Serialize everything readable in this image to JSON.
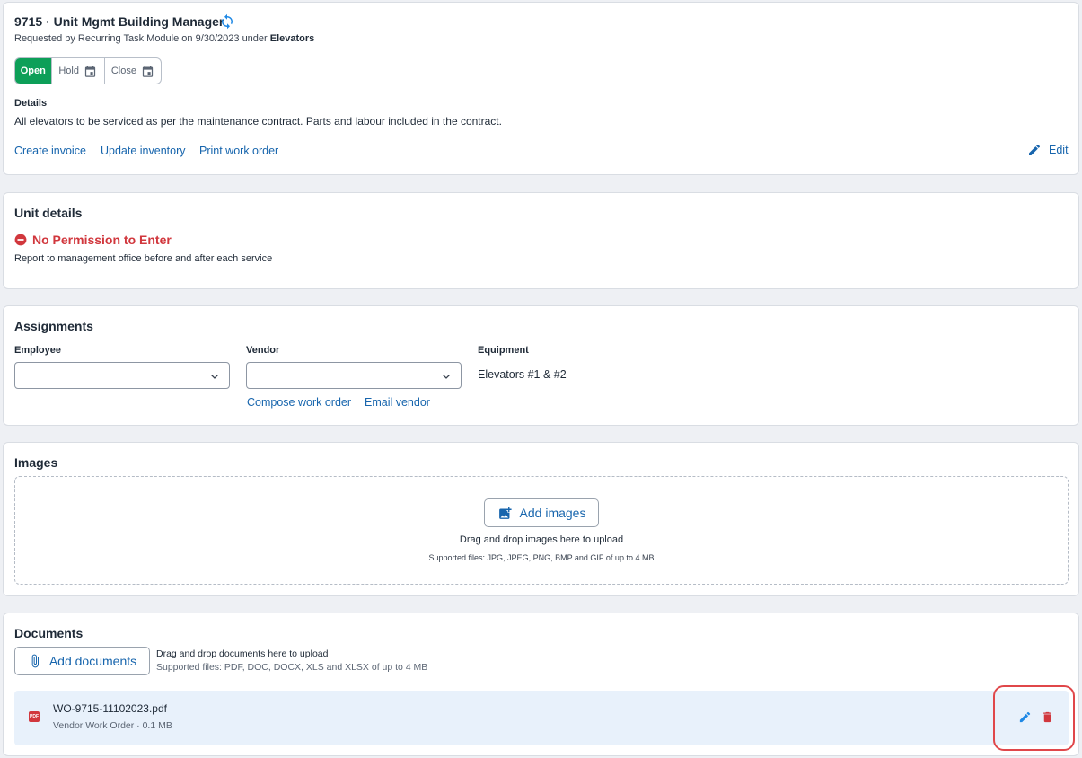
{
  "header": {
    "title": "9715 · Unit Mgmt Building Manager",
    "requested_prefix": "Requested by Recurring Task Module on 9/30/2023 under ",
    "requested_category": "Elevators",
    "status": {
      "open": "Open",
      "hold": "Hold",
      "close": "Close",
      "active": "open"
    },
    "details_label": "Details",
    "details_text": "All elevators to be serviced as per the maintenance contract. Parts and labour included in the contract.",
    "actions": {
      "create_invoice": "Create invoice",
      "update_inventory": "Update inventory",
      "print_work_order": "Print work order"
    },
    "edit_label": "Edit"
  },
  "unit_details": {
    "title": "Unit details",
    "permission": "No Permission to Enter",
    "note": "Report to management office before and after each service"
  },
  "assignments": {
    "title": "Assignments",
    "employee_label": "Employee",
    "employee_value": "",
    "vendor_label": "Vendor",
    "vendor_value": "",
    "equipment_label": "Equipment",
    "equipment_value": "Elevators #1 & #2",
    "compose_work_order": "Compose work order",
    "email_vendor": "Email vendor"
  },
  "images": {
    "title": "Images",
    "add_button": "Add images",
    "drop_hint": "Drag and drop images here to upload",
    "supported": "Supported files: JPG, JPEG, PNG, BMP and GIF of up to 4 MB"
  },
  "documents": {
    "title": "Documents",
    "add_button": "Add documents",
    "drop_hint": "Drag and drop documents here to upload",
    "supported": "Supported files: PDF, DOC, DOCX, XLS and XLSX of up to 4 MB",
    "files": [
      {
        "name": "WO-9715-11102023.pdf",
        "meta": "Vendor Work Order · 0.1 MB",
        "badge": "PDF"
      }
    ]
  },
  "colors": {
    "accent": "#1765ad",
    "open_green": "#0d9f58",
    "danger": "#d1373d"
  }
}
